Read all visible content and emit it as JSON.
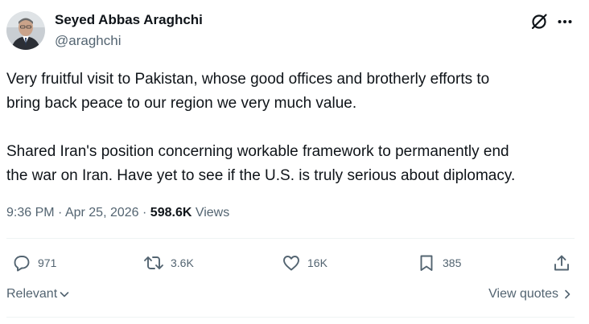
{
  "author": {
    "name": "Seyed Abbas Araghchi",
    "handle": "@araghchi"
  },
  "icons": {
    "header": [
      "grok-icon",
      "more-icon"
    ],
    "actions": [
      "reply-icon",
      "repost-icon",
      "like-icon",
      "bookmark-icon",
      "share-icon"
    ],
    "sort": "chevron-down-icon",
    "quotes": "chevron-right-icon"
  },
  "tweet": {
    "paragraph1": {
      "line1": "Very fruitful visit to Pakistan, whose good offices and brotherly efforts to",
      "line2": "bring back peace to our region we very much value."
    },
    "paragraph2": {
      "line1": "Shared Iran's position concerning workable framework to permanently end",
      "line2": "the war on Iran. Have yet to see if the U.S. is truly serious about diplomacy."
    }
  },
  "meta": {
    "time": "9:36 PM",
    "separator": "·",
    "date": "Apr 25, 2026",
    "views_count": "598.6K",
    "views_label": "Views"
  },
  "actions": {
    "replies": "971",
    "reposts": "3.6K",
    "likes": "16K",
    "bookmarks": "385"
  },
  "footer": {
    "sort_label": "Relevant",
    "view_quotes_label": "View quotes"
  },
  "colors": {
    "text_primary": "#0f1419",
    "text_secondary": "#536471",
    "divider": "#eff3f4"
  }
}
